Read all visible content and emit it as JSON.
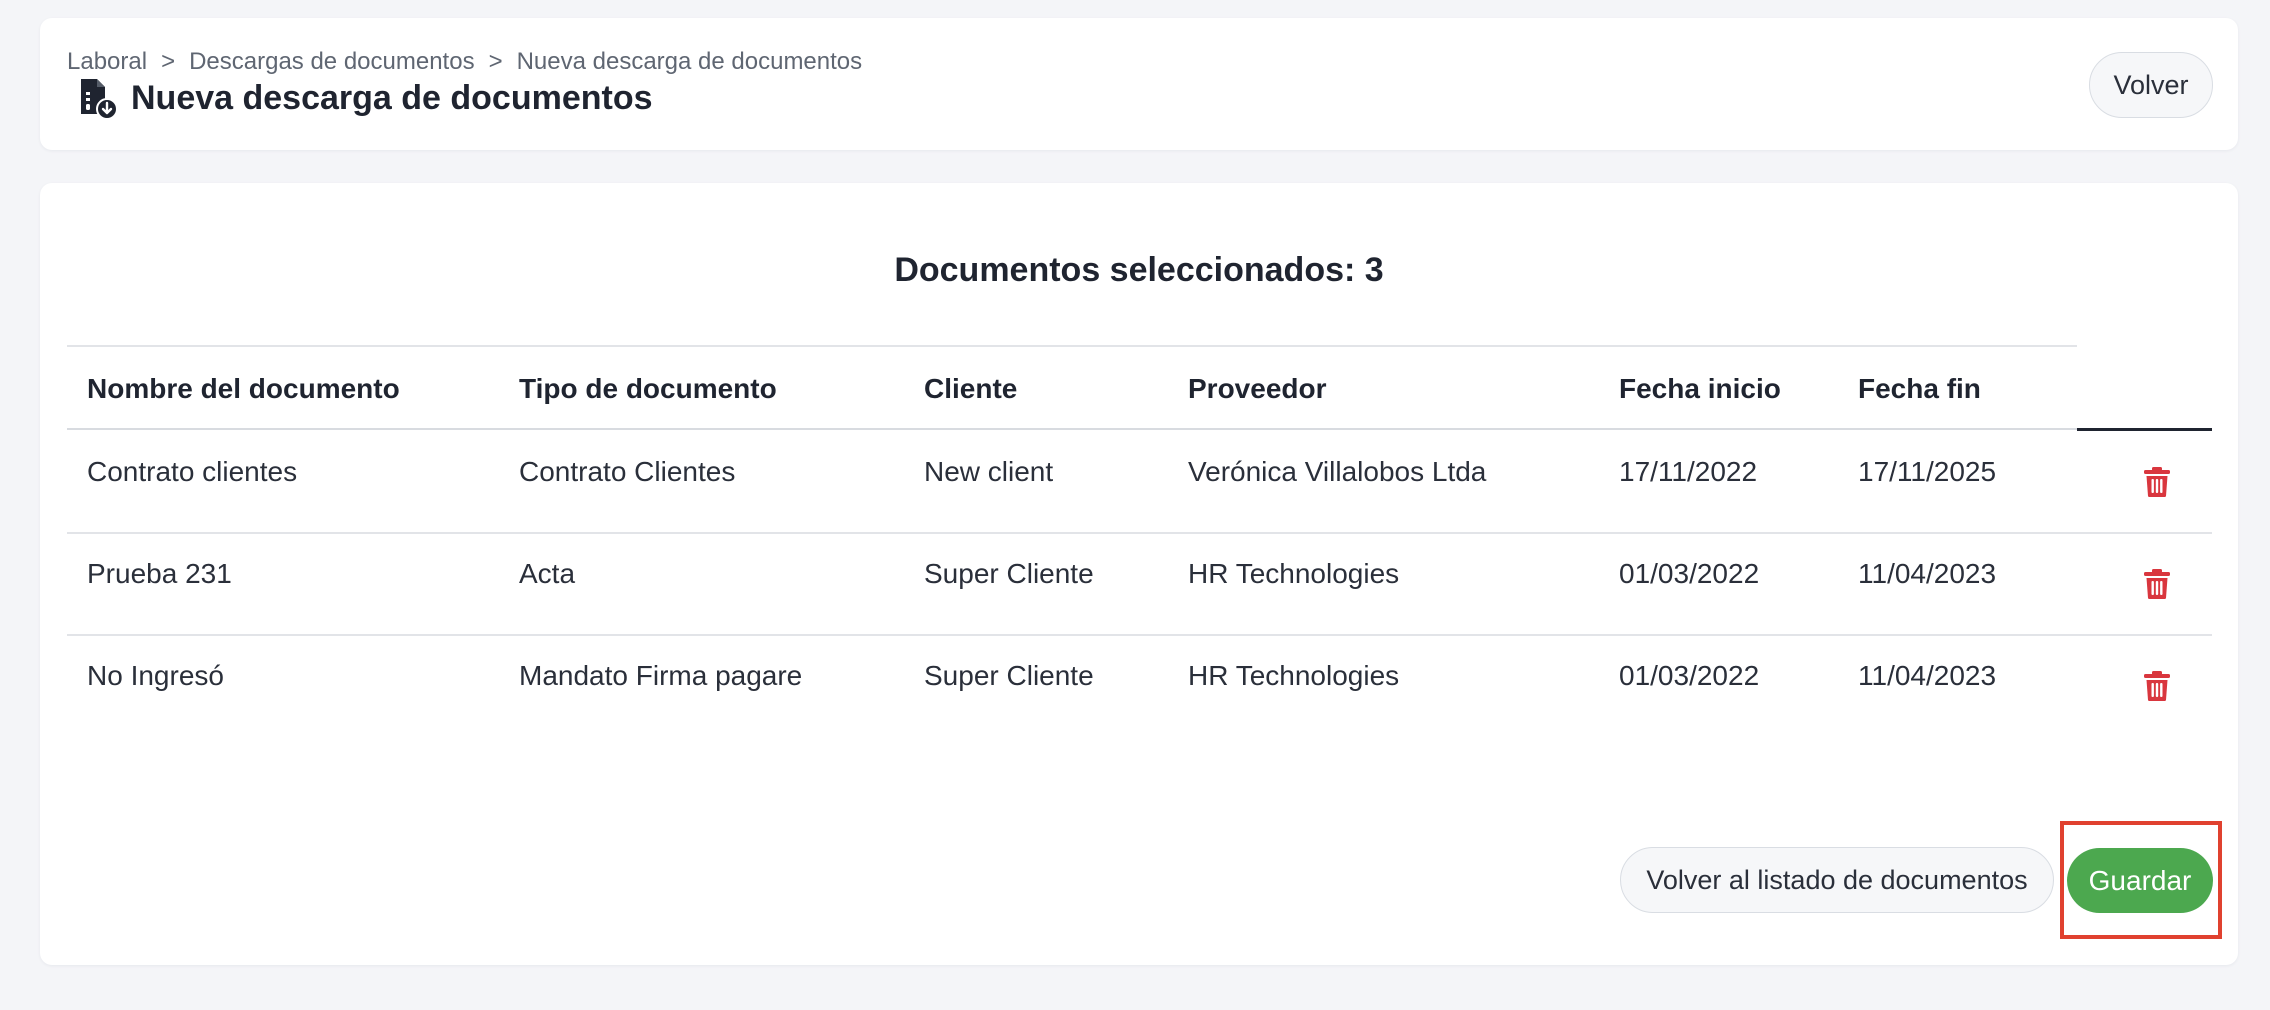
{
  "breadcrumb": [
    "Laboral",
    "Descargas de documentos",
    "Nueva descarga de documentos"
  ],
  "breadcrumb_separator": ">",
  "page_title": "Nueva descarga de documentos",
  "back_button": "Volver",
  "selected_heading": "Documentos seleccionados: 3",
  "table": {
    "headers": [
      "Nombre del documento",
      "Tipo de documento",
      "Cliente",
      "Proveedor",
      "Fecha inicio",
      "Fecha fin"
    ],
    "rows": [
      [
        "Contrato clientes",
        "Contrato Clientes",
        "New client",
        "Verónica Villalobos Ltda",
        "17/11/2022",
        "17/11/2025"
      ],
      [
        "Prueba 231",
        "Acta",
        "Super Cliente",
        "HR Technologies",
        "01/03/2022",
        "11/04/2023"
      ],
      [
        "No Ingresó",
        "Mandato Firma pagare",
        "Super Cliente",
        "HR Technologies",
        "01/03/2022",
        "11/04/2023"
      ]
    ]
  },
  "footer": {
    "back_to_list": "Volver al listado de documentos",
    "save": "Guardar"
  },
  "icons": {
    "title": "document-download-icon",
    "row_action": "trash-icon"
  },
  "colors": {
    "accent_green": "#4ca84f",
    "delete_red": "#d9363e",
    "highlight_red": "#e0412f"
  }
}
